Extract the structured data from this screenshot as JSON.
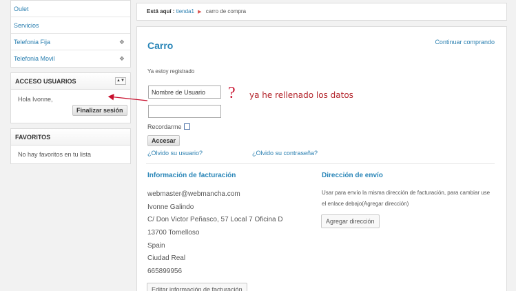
{
  "sidebar": {
    "menu": [
      {
        "label": "Oulet",
        "expandable": false
      },
      {
        "label": "Servicios",
        "expandable": false
      },
      {
        "label": "Telefonia Fija",
        "expandable": true
      },
      {
        "label": "Telefonia Movil",
        "expandable": true
      }
    ],
    "menu_expand_glyph": "❖",
    "users_box": {
      "title": "ACCESO USUARIOS",
      "toggle_label": "▲▼",
      "greeting": "Hola Ivonne,",
      "logout_label": "Finalizar sesión"
    },
    "favorites_box": {
      "title": "FAVORITOS",
      "empty_text": "No hay favoritos en tu lista"
    }
  },
  "breadcrumb": {
    "prefix": "Está aquí :",
    "link": "tienda1",
    "separator": "▶",
    "current": "carro de compra"
  },
  "cart": {
    "title": "Carro",
    "continue_label": "Continuar comprando",
    "registered_label": "Ya estoy registrado",
    "username_value": "Nombre de Usuario",
    "password_value": "",
    "remember_label": "Recordarme",
    "remember_checked": false,
    "login_label": "Accesar",
    "forgot_user": "¿Olvido su usuario?",
    "forgot_pass": "¿Olvido su contraseña?"
  },
  "billing": {
    "title": "Información de facturación",
    "lines": [
      "webmaster@webmancha.com",
      "Ivonne Galindo",
      "C/ Don Victor Peñasco, 57 Local 7 Oficina D",
      "13700 Tomelloso",
      "Spain",
      "Ciudad Real",
      "665899956"
    ],
    "edit_label": "Editar información de facturación"
  },
  "shipping": {
    "title": "Dirección de envío",
    "text": "Usar para envío la misma dirección de facturación, para cambiar use el enlace debajo(Agregar dirección)",
    "add_label": "Agregar dirección"
  },
  "annotation": {
    "question_mark": "?",
    "note": "ya he rellenado los datos",
    "color": "#c8102e"
  }
}
